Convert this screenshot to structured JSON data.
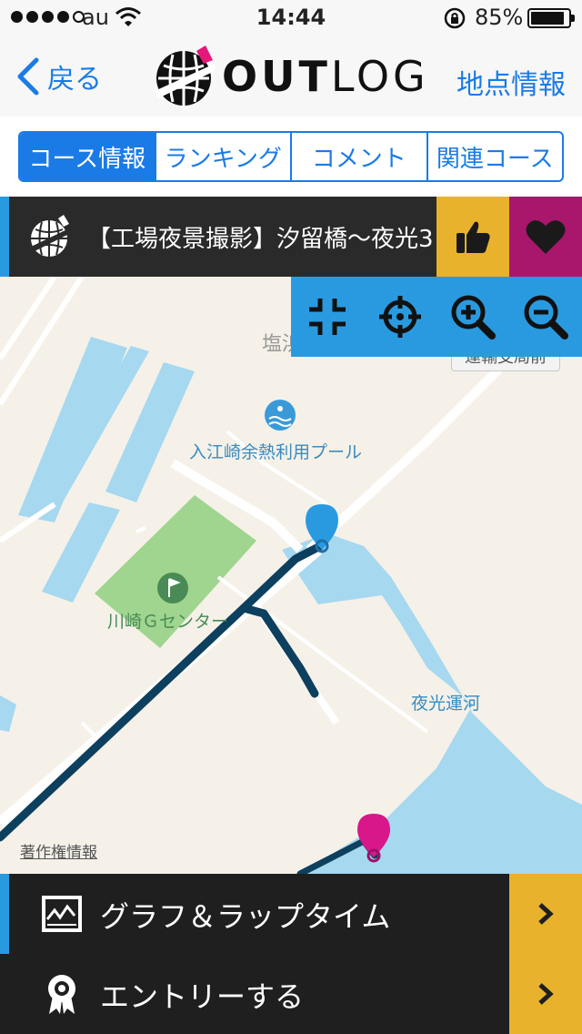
{
  "status_bar": {
    "carrier": "au",
    "time": "14:44",
    "battery_percent": "85%",
    "battery_level": 0.85,
    "signal_bars": 5,
    "signal_filled": 4
  },
  "nav": {
    "back_label": "戻る",
    "logo_text_bold": "OUT",
    "logo_text_light": "LOG",
    "right_label": "地点情報"
  },
  "tabs": [
    {
      "label": "コース情報",
      "active": true
    },
    {
      "label": "ランキング",
      "active": false
    },
    {
      "label": "コメント",
      "active": false
    },
    {
      "label": "関連コース",
      "active": false
    }
  ],
  "course": {
    "title": "【工場夜景撮影】汐留橋〜夜光3",
    "like_icon": "thumbs-up-icon",
    "favorite_icon": "heart-icon"
  },
  "map": {
    "labels": {
      "pool": "入江崎余熱利用プール",
      "golf": "川崎Ｇセンター",
      "canal": "夜光運河",
      "area_partial": "塩浜",
      "station_partial": "運輸支局前"
    },
    "copyright": "著作権情報",
    "tools": [
      "shrink-icon",
      "locate-icon",
      "zoom-in-icon",
      "zoom-out-icon"
    ]
  },
  "menu": [
    {
      "label": "グラフ＆ラップタイム",
      "icon": "graph-icon"
    },
    {
      "label": "エントリーする",
      "icon": "award-icon"
    }
  ],
  "colors": {
    "accent_blue": "#1a7be6",
    "map_toolbar_blue": "#2a9ae0",
    "like_yellow": "#e8b22c",
    "favorite_magenta": "#a8176c",
    "route_navy": "#0d3f5e",
    "water_blue": "#a6d8f0",
    "park_green": "#9fd58e"
  }
}
